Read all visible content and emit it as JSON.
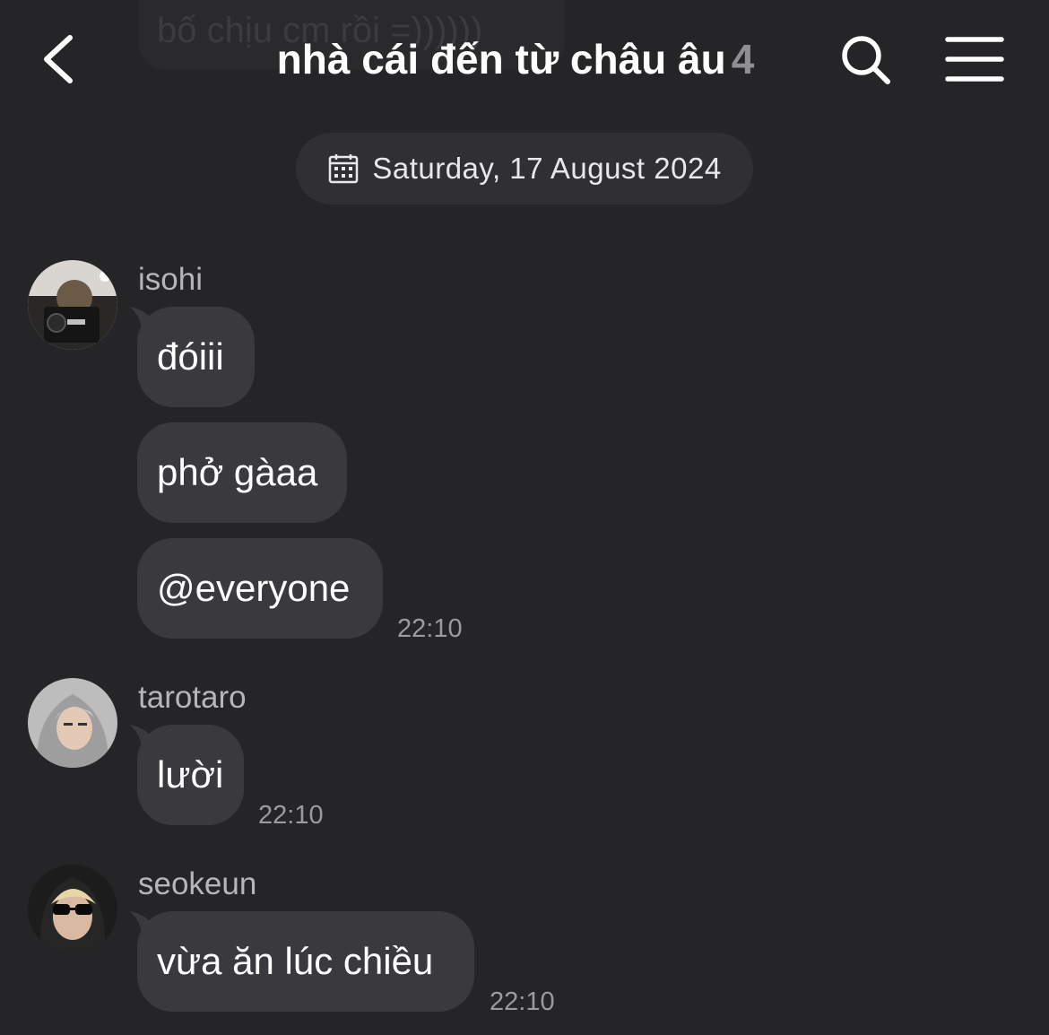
{
  "background_message": {
    "text": "bố chịu cm rồi =))))))"
  },
  "header": {
    "back_icon": "chevron-left-icon",
    "title": "nhà cái đến từ châu âu",
    "member_count": "4",
    "search_icon": "search-icon",
    "menu_icon": "hamburger-menu-icon"
  },
  "date_divider": {
    "icon": "calendar-icon",
    "label": "Saturday, 17 August 2024"
  },
  "messages": [
    {
      "sender": "isohi",
      "bubbles": [
        "đóiii",
        "phở gàaa",
        "@everyone"
      ],
      "time": "22:10"
    },
    {
      "sender": "tarotaro",
      "bubbles": [
        "lười"
      ],
      "time": "22:10"
    },
    {
      "sender": "seokeun",
      "bubbles": [
        "vừa ăn lúc chiều"
      ],
      "time": "22:10"
    }
  ],
  "colors": {
    "background": "#252528",
    "bubble": "#3a3a3e",
    "pill": "#303034",
    "secondary_text": "#9a9aa0"
  }
}
